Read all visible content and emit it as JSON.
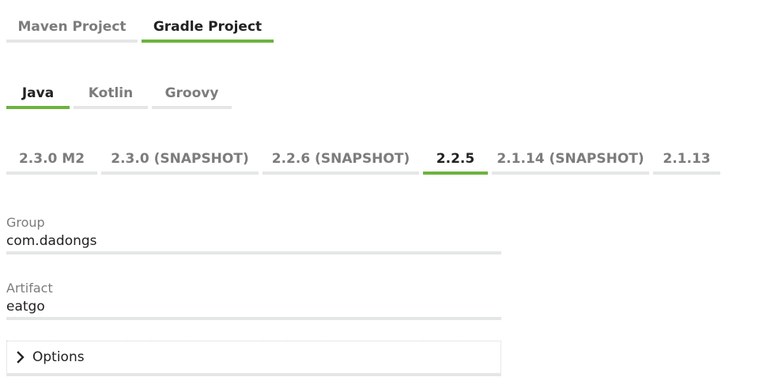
{
  "project": {
    "tabs": [
      {
        "label": "Maven Project",
        "active": false
      },
      {
        "label": "Gradle Project",
        "active": true
      }
    ]
  },
  "language": {
    "tabs": [
      {
        "label": "Java",
        "active": true
      },
      {
        "label": "Kotlin",
        "active": false
      },
      {
        "label": "Groovy",
        "active": false
      }
    ]
  },
  "spring_boot": {
    "tabs": [
      {
        "label": "2.3.0 M2",
        "active": false
      },
      {
        "label": "2.3.0 (SNAPSHOT)",
        "active": false
      },
      {
        "label": "2.2.6 (SNAPSHOT)",
        "active": false
      },
      {
        "label": "2.2.5",
        "active": true
      },
      {
        "label": "2.1.14 (SNAPSHOT)",
        "active": false
      },
      {
        "label": "2.1.13",
        "active": false
      }
    ]
  },
  "fields": {
    "group": {
      "label": "Group",
      "value": "com.dadongs"
    },
    "artifact": {
      "label": "Artifact",
      "value": "eatgo"
    }
  },
  "options": {
    "label": "Options",
    "icon": "chevron-right-icon"
  },
  "colors": {
    "accent": "#6db33f",
    "inactive_border": "#e5e6e6",
    "inactive_text": "#7c7c7c",
    "text": "#222222"
  }
}
